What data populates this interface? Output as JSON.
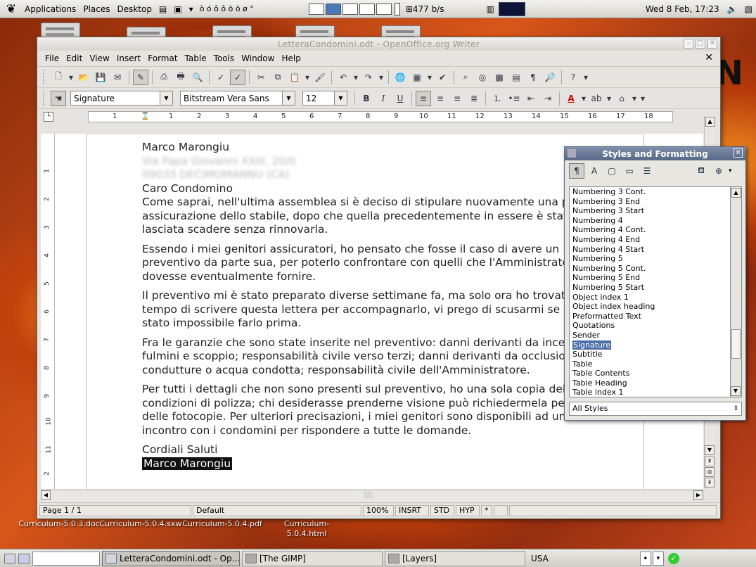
{
  "topbar": {
    "menus": [
      "Applications",
      "Places",
      "Desktop"
    ],
    "symbols": "ò ó ô ô ö ö ø °",
    "net_speed": "477 b/s",
    "clock": "Wed 8 Feb, 17:23"
  },
  "desktop": {
    "icons": [
      {
        "label": "Curriculum-5.0.3.doc"
      },
      {
        "label": "Curriculum-5.0.4.sxw"
      },
      {
        "label": "Curriculum-5.0.4.pdf"
      },
      {
        "label": "Curriculum-5.0.4.html"
      }
    ]
  },
  "window": {
    "title": "LetteraCondomini.odt - OpenOffice.org Writer",
    "menus": [
      "File",
      "Edit",
      "View",
      "Insert",
      "Format",
      "Table",
      "Tools",
      "Window",
      "Help"
    ],
    "format_bar": {
      "paragraph_style": "Signature",
      "font_name": "Bitstream Vera Sans",
      "font_size": "12"
    }
  },
  "document": {
    "sender_name": "Marco Marongiu",
    "address_line1": "Via Papa Giovanni XXIII, 20/0",
    "address_line2": "09033 DECIMOMANNU (CA)",
    "greeting": "Caro Condomino",
    "paragraphs": [
      "Come saprai, nell'ultima assemblea si è deciso di stipulare nuovamente una polizza di assicurazione dello stabile, dopo che quella precedentemente in essere è stata lasciata scadere senza rinnovarla.",
      "Essendo i miei genitori assicuratori, ho pensato che fosse il caso di avere un preventivo da parte sua, per poterlo confrontare con quelli che l'Amministratore dovesse eventualmente fornire.",
      "Il preventivo mi è stato preparato diverse settimane fa, ma solo ora ho trovato il tempo di scrivere questa lettera per accompagnarlo, vi prego di scusarmi se non mi è stato impossibile farlo prima.",
      "Fra le garanzie che sono state inserite nel preventivo: danni derivanti da incendio, fulmini e scoppio; responsabilità civile verso terzi; danni derivanti da occlusione di condutture o acqua condotta; responsabilità civile dell'Amministratore.",
      "Per tutti i dettagli che non sono presenti sul preventivo, ho una sola copia delle condizioni di polizza; chi desiderasse prenderne visione può richiedermela per fare delle fotocopie. Per ulteriori precisazioni, i miei genitori sono disponibili ad un incontro con i condomini per rispondere a tutte le domande."
    ],
    "closing": "Cordiali Saluti",
    "signature": "Marco Marongiu"
  },
  "statusbar": {
    "page": "Page 1 / 1",
    "page_style": "Default",
    "zoom": "100%",
    "insert_mode": "INSRT",
    "selection_mode": "STD",
    "hyperlink_mode": "HYP",
    "modified": "*"
  },
  "styles_panel": {
    "title": "Styles and Formatting",
    "items": [
      "Numbering 3 Cont.",
      "Numbering 3 End",
      "Numbering 3 Start",
      "Numbering 4",
      "Numbering 4 Cont.",
      "Numbering 4 End",
      "Numbering 4 Start",
      "Numbering 5",
      "Numbering 5 Cont.",
      "Numbering 5 End",
      "Numbering 5 Start",
      "Object index 1",
      "Object index heading",
      "Preformatted Text",
      "Quotations",
      "Sender",
      "Signature",
      "Subtitle",
      "Table",
      "Table Contents",
      "Table Heading",
      "Table index 1"
    ],
    "selected": "Signature",
    "filter": "All Styles"
  },
  "taskbar": {
    "tasks": [
      "LetteraCondomini.odt - Op...",
      "[The GIMP]",
      "[Layers]"
    ],
    "keyboard_layout": "USA"
  }
}
